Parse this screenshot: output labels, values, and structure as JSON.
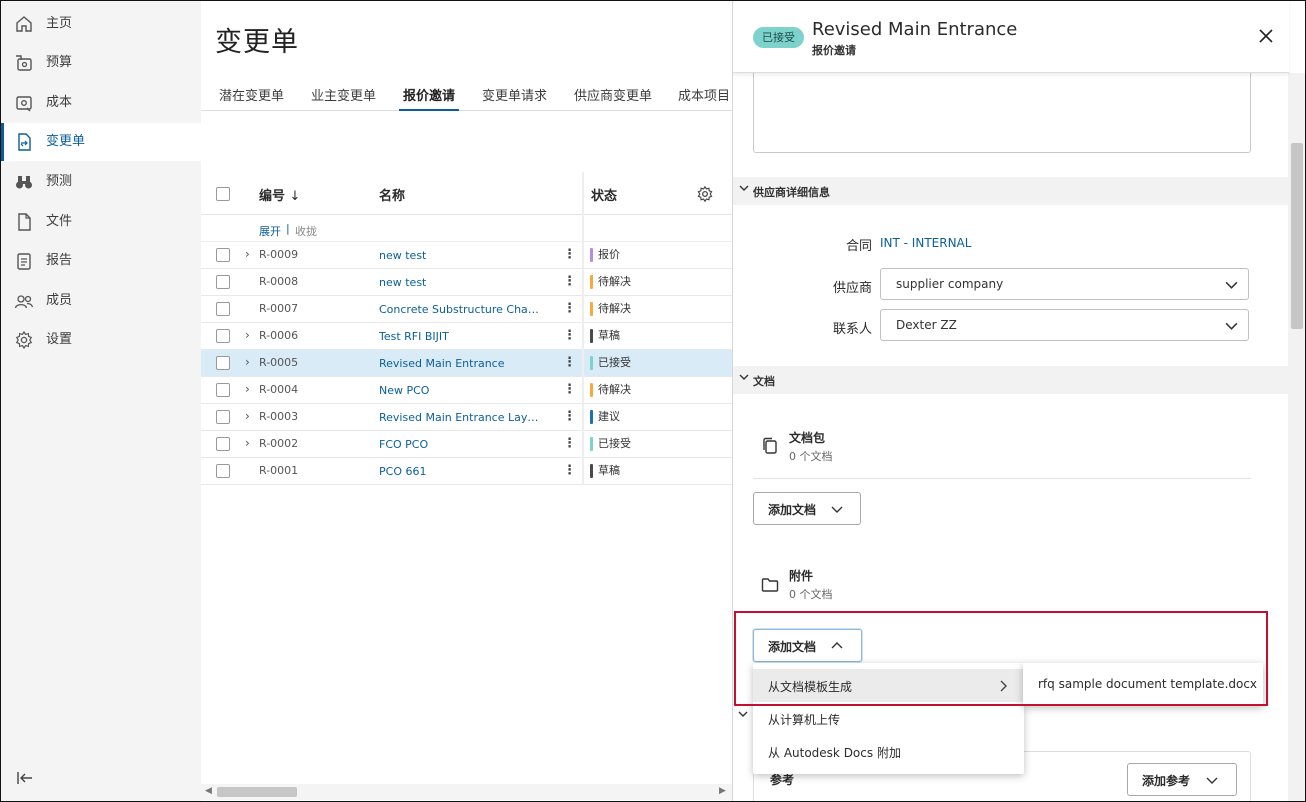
{
  "sidebar": {
    "items": [
      {
        "label": "主页",
        "icon": "home-icon"
      },
      {
        "label": "预算",
        "icon": "budget-icon"
      },
      {
        "label": "成本",
        "icon": "cost-icon"
      },
      {
        "label": "变更单",
        "icon": "change-order-icon"
      },
      {
        "label": "预测",
        "icon": "binoculars-icon"
      },
      {
        "label": "文件",
        "icon": "file-icon"
      },
      {
        "label": "报告",
        "icon": "report-icon"
      },
      {
        "label": "成员",
        "icon": "members-icon"
      },
      {
        "label": "设置",
        "icon": "gear-icon"
      }
    ],
    "active_index": 3
  },
  "main": {
    "title": "变更单",
    "tabs": [
      "潜在变更单",
      "业主变更单",
      "报价邀请",
      "变更单请求",
      "供应商变更单",
      "成本项目"
    ],
    "active_tab": 2,
    "table": {
      "columns": {
        "number": "编号",
        "name": "名称",
        "status": "状态"
      },
      "expand_label": "展开",
      "collapse_label": "收拢",
      "rows": [
        {
          "number": "R-0009",
          "name": "new test",
          "status": "报价",
          "status_color": "#b78ae6",
          "expandable": true,
          "selected": false
        },
        {
          "number": "R-0008",
          "name": "new test",
          "status": "待解决",
          "status_color": "#f7a93b",
          "expandable": false,
          "selected": false
        },
        {
          "number": "R-0007",
          "name": "Concrete Substructure Change",
          "status": "待解决",
          "status_color": "#f7a93b",
          "expandable": false,
          "selected": false
        },
        {
          "number": "R-0006",
          "name": "Test RFI BIJIT",
          "status": "草稿",
          "status_color": "#4a4a4a",
          "expandable": true,
          "selected": false
        },
        {
          "number": "R-0005",
          "name": "Revised Main Entrance",
          "status": "已接受",
          "status_color": "#7dd3cb",
          "expandable": true,
          "selected": true
        },
        {
          "number": "R-0004",
          "name": "New PCO",
          "status": "待解决",
          "status_color": "#f7a93b",
          "expandable": true,
          "selected": false
        },
        {
          "number": "R-0003",
          "name": "Revised Main Entrance Layout ...",
          "status": "建议",
          "status_color": "#1f6fb2",
          "expandable": true,
          "selected": false
        },
        {
          "number": "R-0002",
          "name": "FCO PCO",
          "status": "已接受",
          "status_color": "#7dd3cb",
          "expandable": true,
          "selected": false
        },
        {
          "number": "R-0001",
          "name": "PCO 661",
          "status": "草稿",
          "status_color": "#4a4a4a",
          "expandable": false,
          "selected": false
        }
      ]
    }
  },
  "panel": {
    "badge": "已接受",
    "title": "Revised Main Entrance",
    "subtitle": "报价邀请",
    "supplier_section": "供应商详细信息",
    "contract_label": "合同",
    "contract_value": "INT - INTERNAL",
    "supplier_label": "供应商",
    "supplier_value": "supplier company",
    "contact_label": "联系人",
    "contact_value": "Dexter ZZ",
    "docs_section": "文档",
    "doc_package_title": "文档包",
    "doc_package_count": "0 个文档",
    "add_doc_label": "添加文档",
    "attachments_title": "附件",
    "attachments_count": "0 个文档",
    "add_doc_label_2": "添加文档",
    "menu": [
      "从文档模板生成",
      "从计算机上传",
      "从 Autodesk Docs 附加"
    ],
    "submenu_item": "rfq sample document template.docx",
    "references_label": "参考",
    "add_reference_label": "添加参考"
  },
  "colors": {
    "accent": "#0b5f99",
    "highlight": "#c0122e",
    "badge": "#7dd3cb"
  }
}
